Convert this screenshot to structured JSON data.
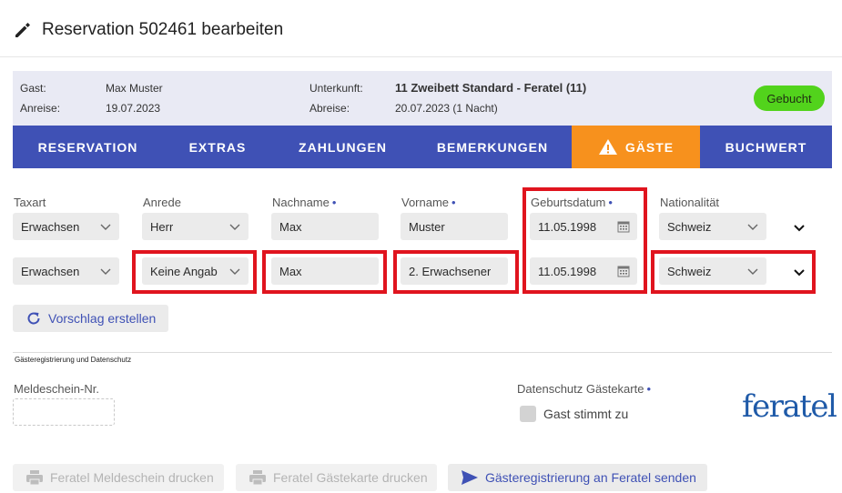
{
  "page": {
    "title": "Reservation 502461 bearbeiten",
    "edit_icon": "pencil-icon"
  },
  "summary": {
    "guest_label": "Gast:",
    "guest_value": "Max Muster",
    "arrival_label": "Anreise:",
    "arrival_value": "19.07.2023",
    "lodging_label": "Unterkunft:",
    "lodging_value": "11 Zweibett Standard - Feratel (11)",
    "departure_label": "Abreise:",
    "departure_value": "20.07.2023 (1 Nacht)",
    "status": "Gebucht"
  },
  "tabs": [
    {
      "label": "RESERVATION"
    },
    {
      "label": "EXTRAS"
    },
    {
      "label": "ZAHLUNGEN"
    },
    {
      "label": "BEMERKUNGEN"
    },
    {
      "label": "GÄSTE",
      "icon": "warning-icon"
    },
    {
      "label": "BUCHWERT"
    }
  ],
  "guests_table": {
    "columns": {
      "taxart": "Taxart",
      "anrede": "Anrede",
      "nachname": "Nachname",
      "vorname": "Vorname",
      "geburtsdatum": "Geburtsdatum",
      "nationalitaet": "Nationalität"
    },
    "required_marker": "•",
    "rows": [
      {
        "taxart": "Erwachsen",
        "anrede": "Herr",
        "nachname": "Max",
        "vorname": "Muster",
        "geburtsdatum": "11.05.1998",
        "nationalitaet": "Schweiz"
      },
      {
        "taxart": "Erwachsen",
        "anrede": "Keine Angab",
        "nachname": "Max",
        "vorname": "2. Erwachsener",
        "geburtsdatum": "11.05.1998",
        "nationalitaet": "Schweiz"
      }
    ]
  },
  "suggest_button": "Vorschlag erstellen",
  "registration": {
    "section_title": "Gästeregistrierung und Datenschutz",
    "meldeschein_label": "Meldeschein-Nr.",
    "meldeschein_value": "",
    "privacy_label": "Datenschutz Gästekarte",
    "consent_label": "Gast stimmt zu",
    "consent_checked": false,
    "logo_text": "feratel"
  },
  "actions": {
    "print_meldeschein": "Feratel Meldeschein drucken",
    "print_gaestekarte": "Feratel Gästekarte drucken",
    "send": "Gästeregistrierung an Feratel senden"
  },
  "colors": {
    "primary": "#3f51b5",
    "active_tab": "#f7911d",
    "status": "#52d31c",
    "highlight": "#e0141e",
    "info_panel": "#e9eaf4"
  }
}
